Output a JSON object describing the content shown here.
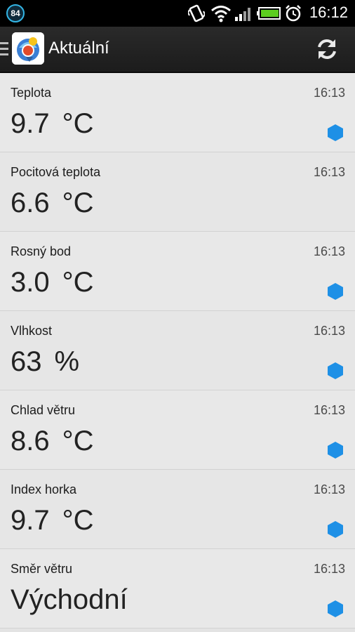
{
  "status_bar": {
    "notification_count": "84",
    "time": "16:12",
    "icons": [
      "vibrate-icon",
      "wifi-icon",
      "signal-icon",
      "battery-icon",
      "alarm-icon"
    ]
  },
  "action_bar": {
    "title": "Aktuální",
    "icons": [
      "drawer-icon",
      "app-logo-icon",
      "refresh-icon"
    ]
  },
  "colors": {
    "accent": "#1e90e6",
    "statusbar_bg": "#000000",
    "actionbar_bg": "#222222",
    "list_bg": "#e6e6e6"
  },
  "readings": [
    {
      "label": "Teplota",
      "time": "16:13",
      "value": "9.7",
      "unit": "°C",
      "indicator": true
    },
    {
      "label": "Pocitová teplota",
      "time": "16:13",
      "value": "6.6",
      "unit": "°C",
      "indicator": false
    },
    {
      "label": "Rosný bod",
      "time": "16:13",
      "value": "3.0",
      "unit": "°C",
      "indicator": true
    },
    {
      "label": "Vlhkost",
      "time": "16:13",
      "value": "63",
      "unit": "%",
      "indicator": true
    },
    {
      "label": "Chlad větru",
      "time": "16:13",
      "value": "8.6",
      "unit": "°C",
      "indicator": true
    },
    {
      "label": "Index horka",
      "time": "16:13",
      "value": "9.7",
      "unit": "°C",
      "indicator": true
    },
    {
      "label": "Směr větru",
      "time": "16:13",
      "value": "Východní",
      "unit": "",
      "indicator": true
    }
  ]
}
